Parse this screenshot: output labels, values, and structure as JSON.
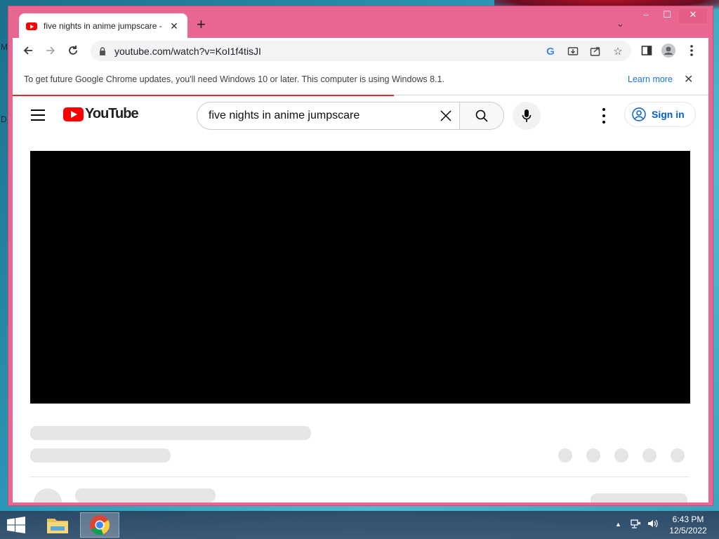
{
  "desktop": {
    "edge_letters": [
      "M",
      "D"
    ]
  },
  "tab": {
    "title": "five nights in anime jumpscare -",
    "close_label": "✕",
    "favicon": "youtube-favicon"
  },
  "window_controls": {
    "minimize": "–",
    "maximize": "☐",
    "close": "✕",
    "tab_search": "⌄",
    "new_tab": "+"
  },
  "address_bar": {
    "url": "youtube.com/watch?v=KoI1f4tisJI"
  },
  "infobar": {
    "message": "To get future Google Chrome updates, you'll need Windows 10 or later. This computer is using Windows 8.1.",
    "learn_more": "Learn more",
    "close": "✕"
  },
  "youtube": {
    "logo_text": "YouTube",
    "search_value": "five nights in anime jumpscare",
    "signin_label": "Sign in"
  },
  "taskbar": {
    "time": "6:43 PM",
    "date": "12/5/2022",
    "tray_arrow": "▲"
  },
  "colors": {
    "window_frame": "#e8668f",
    "youtube_red": "#ff0000",
    "link_blue": "#065fd4",
    "load_bar": "#e3262b"
  }
}
